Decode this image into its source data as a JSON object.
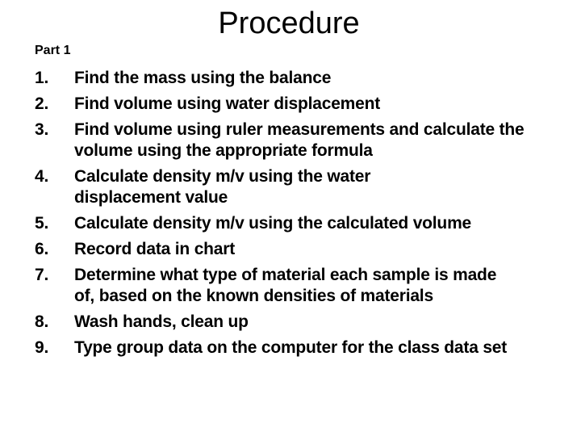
{
  "slide": {
    "title": "Procedure",
    "subtitle": "Part 1",
    "steps": [
      {
        "number": "1.",
        "text": "Find the mass using the balance"
      },
      {
        "number": "2.",
        "text": "Find volume using water displacement"
      },
      {
        "number": "3.",
        "text": "Find volume using ruler measurements and calculate the volume using the appropriate formula"
      },
      {
        "number": "4.",
        "text": "Calculate density m/v using the water displacement value"
      },
      {
        "number": "5.",
        "text": "Calculate density m/v using the calculated volume"
      },
      {
        "number": "6.",
        "text": "Record data in chart"
      },
      {
        "number": "7.",
        "text": "Determine what type of material each sample is made of, based on the known densities of materials"
      },
      {
        "number": "8.",
        "text": "Wash hands, clean up"
      },
      {
        "number": "9.",
        "text": "Type group data on the computer for the class data set"
      }
    ]
  }
}
